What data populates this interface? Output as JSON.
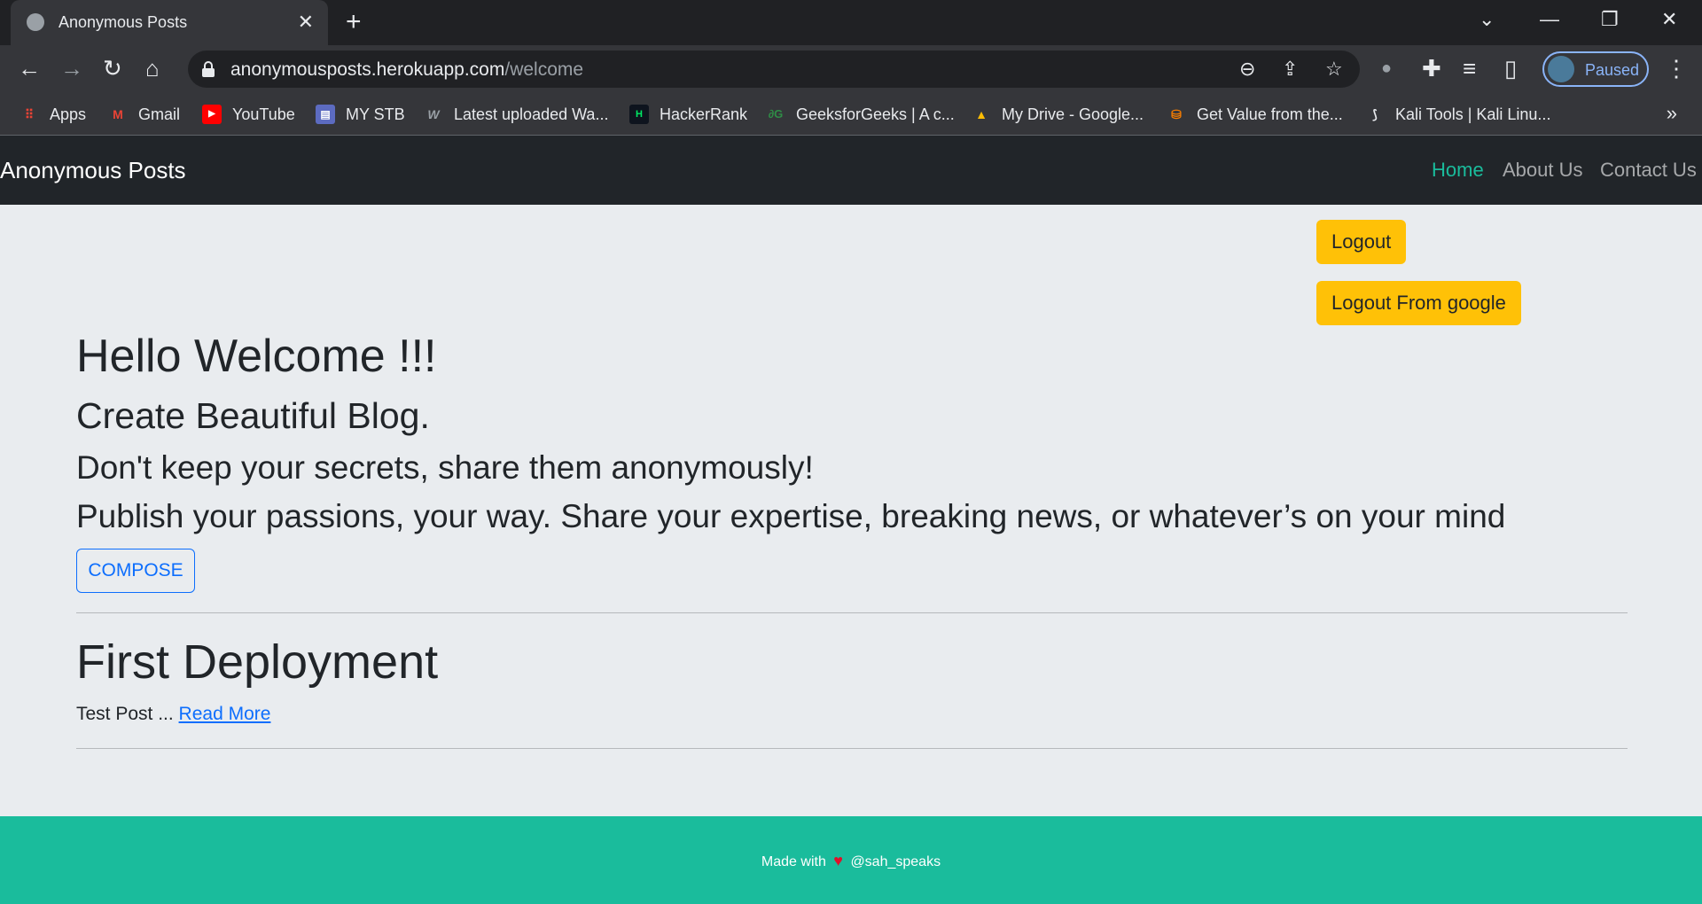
{
  "browser": {
    "tab_title": "Anonymous Posts",
    "url_host": "anonymousposts.herokuapp.com",
    "url_path": "/welcome",
    "profile_label": "Paused",
    "bookmarks": [
      {
        "label": "Apps",
        "icon": "apps-grid-icon",
        "color": "#ea4335"
      },
      {
        "label": "Gmail",
        "icon": "gmail-icon",
        "color": "#ea4335"
      },
      {
        "label": "YouTube",
        "icon": "youtube-icon",
        "color": "#ff0000"
      },
      {
        "label": "MY STB",
        "icon": "stb-icon",
        "color": "#5c6bc0"
      },
      {
        "label": "Latest uploaded Wa...",
        "icon": "wallpaper-w-icon",
        "color": "#9aa0a6"
      },
      {
        "label": "HackerRank",
        "icon": "hackerrank-icon",
        "color": "#00ea64"
      },
      {
        "label": "GeeksforGeeks | A c...",
        "icon": "geeksforgeeks-icon",
        "color": "#2f8d46"
      },
      {
        "label": "My Drive - Google...",
        "icon": "google-drive-icon",
        "color": "#fbbc04"
      },
      {
        "label": "Get Value from the...",
        "icon": "value-icon",
        "color": "#f57c00"
      },
      {
        "label": "Kali Tools | Kali Linu...",
        "icon": "kali-dragon-icon",
        "color": "#e8eaed"
      }
    ]
  },
  "nav": {
    "brand": "Anonymous Posts",
    "links": [
      "Home",
      "About Us",
      "Contact Us"
    ]
  },
  "actions": {
    "logout": "Logout",
    "logout_google": "Logout From google"
  },
  "hero": {
    "title": "Hello Welcome !!!",
    "subtitle": "Create Beautiful Blog.",
    "line1": "Don't keep your secrets, share them anonymously!",
    "line2": "Publish your passions, your way. Share your expertise, breaking news, or whatever’s on your mind",
    "compose": "COMPOSE"
  },
  "posts": [
    {
      "title": "First Deployment",
      "excerpt": "Test Post ... ",
      "read_more": "Read More"
    }
  ],
  "footer": {
    "prefix": "Made with",
    "handle": "@sah_speaks"
  },
  "colors": {
    "accent": "#1abc9c",
    "warning": "#ffc107",
    "primary": "#0d6efd",
    "navbar": "#212529"
  }
}
